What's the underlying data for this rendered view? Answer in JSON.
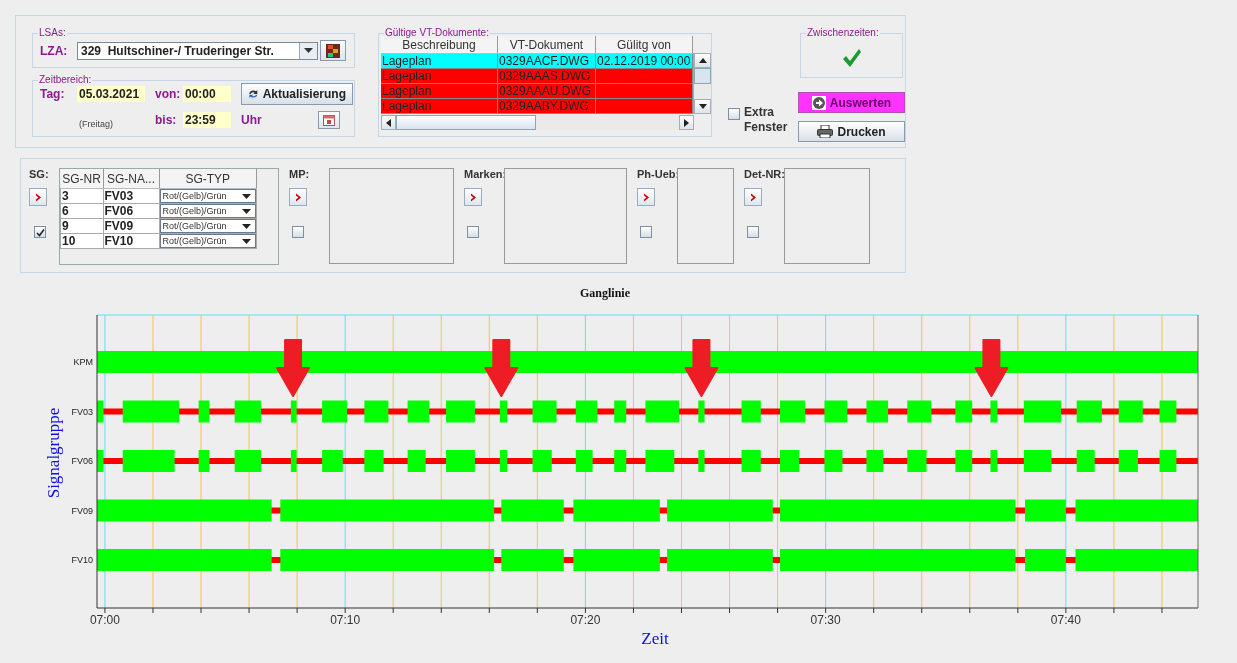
{
  "lsa": {
    "legend": "LSAs:",
    "label": "LZA:",
    "value": "329  Hultschiner-/ Truderinger Str."
  },
  "zeitbereich": {
    "legend": "Zeitbereich:",
    "tag_label": "Tag:",
    "tag_value": "05.03.2021",
    "weekday": "(Freitag)",
    "von_label": "von:",
    "von_value": "00:00",
    "bis_label": "bis:",
    "bis_value": "23:59",
    "unit": "Uhr",
    "refresh_button": "Aktualisierung"
  },
  "vt_documents": {
    "legend": "Gültige VT-Dokumente:",
    "columns": [
      "Beschreibung",
      "VT-Dokument",
      "Gülitg von"
    ],
    "rows": [
      {
        "cells": [
          "Lageplan",
          "0329AACF.DWG",
          "02.12.2019 00:00"
        ],
        "color": "#00ffff"
      },
      {
        "cells": [
          "Lageplan",
          "0329AAAS.DWG",
          ""
        ],
        "color": "#ff0000"
      },
      {
        "cells": [
          "Lageplan",
          "0329AAAU.DWG",
          ""
        ],
        "color": "#ff0000"
      },
      {
        "cells": [
          "Lageplan",
          "0329AABY.DWG",
          ""
        ],
        "color": "#ff0000"
      }
    ]
  },
  "extra_window": {
    "label": "Extra Fenster",
    "checked": false
  },
  "zwischenzeiten": {
    "legend": "Zwischenzeiten:",
    "ok": true
  },
  "buttons": [
    {
      "label": "Auswerten",
      "kind": "evaluate"
    },
    {
      "label": "Drucken",
      "kind": "print"
    }
  ],
  "selectors": [
    {
      "label": "SG:",
      "kind": "table",
      "checked": true,
      "columns": [
        "SG-NR",
        "SG-NA...",
        "SG-TYP"
      ],
      "rows": [
        {
          "nr": "3",
          "name": "FV03",
          "type": "Rot/(Gelb)/Grün"
        },
        {
          "nr": "6",
          "name": "FV06",
          "type": "Rot/(Gelb)/Grün"
        },
        {
          "nr": "9",
          "name": "FV09",
          "type": "Rot/(Gelb)/Grün"
        },
        {
          "nr": "10",
          "name": "FV10",
          "type": "Rot/(Gelb)/Grün"
        }
      ]
    },
    {
      "label": "MP:",
      "kind": "list",
      "checked": false
    },
    {
      "label": "Marken:",
      "kind": "list",
      "checked": false
    },
    {
      "label": "Ph-Ueb:",
      "kind": "narrow",
      "checked": false
    },
    {
      "label": "Det-NR:",
      "kind": "list",
      "checked": false
    }
  ],
  "timeline": {
    "title": "Ganglinie",
    "xlabel": "Zeit",
    "ylabel": "Signalgruppe",
    "rows": [
      {
        "label": "KPM"
      },
      {
        "label": "FV03"
      },
      {
        "label": "FV06"
      },
      {
        "label": "FV09"
      },
      {
        "label": "FV10"
      }
    ],
    "tick_labels": [
      "07:00",
      "07:10",
      "07:20",
      "07:30",
      "07:40"
    ]
  }
}
